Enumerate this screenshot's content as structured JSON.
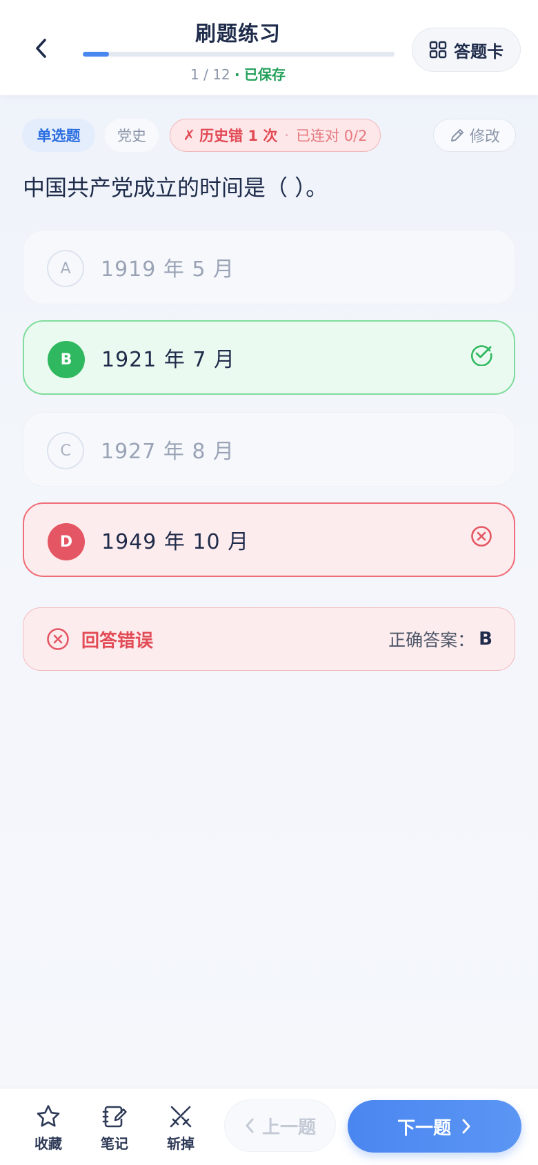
{
  "header": {
    "title": "刷题练习",
    "progress_text": "1 / 12",
    "progress_fraction": 0.0833,
    "separator": "·",
    "saved_label": "已保存",
    "card_button_label": "答题卡"
  },
  "tags": {
    "type": "单选题",
    "subject": "党史",
    "history_mark": "✗",
    "history_wrong": "历史错 1 次",
    "history_dot": "·",
    "history_streak": "已连对 0/2",
    "edit_label": "修改"
  },
  "question": {
    "text": "中国共产党成立的时间是（ ）。",
    "options": [
      {
        "letter": "A",
        "text": "1919 年 5 月",
        "state": "neutral"
      },
      {
        "letter": "B",
        "text": "1921 年 7 月",
        "state": "correct"
      },
      {
        "letter": "C",
        "text": "1927 年 8 月",
        "state": "neutral"
      },
      {
        "letter": "D",
        "text": "1949 年 10 月",
        "state": "wrong"
      }
    ]
  },
  "result": {
    "label": "回答错误",
    "answer_prefix": "正确答案：",
    "answer_key": "B"
  },
  "bottom": {
    "fav_label": "收藏",
    "note_label": "笔记",
    "cut_label": "斩掉",
    "prev_label": "上一题",
    "next_label": "下一题"
  },
  "colors": {
    "accent": "#4a86f0",
    "correct": "#2fb85f",
    "wrong": "#e45663",
    "saved": "#22a05a"
  }
}
